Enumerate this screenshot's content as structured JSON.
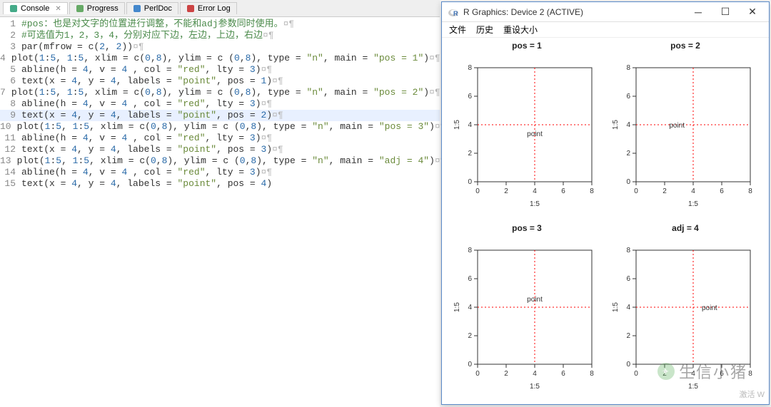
{
  "tabs": [
    {
      "label": "Console",
      "icon": "console-icon",
      "active": true
    },
    {
      "label": "Progress",
      "icon": "progress-icon",
      "active": false
    },
    {
      "label": "PerlDoc",
      "icon": "perldoc-icon",
      "active": false
    },
    {
      "label": "Error Log",
      "icon": "errorlog-icon",
      "active": false
    }
  ],
  "code": {
    "highlighted": 9,
    "lines": [
      {
        "n": 1,
        "seg": [
          [
            "c-comment",
            "#pos：也是对文字的位置进行调整，不能和adj参数同时使用。"
          ]
        ],
        "eol": "¤¶"
      },
      {
        "n": 2,
        "seg": [
          [
            "c-comment",
            "#可选值为1，2，3，4，分别对应下边，左边，上边，右边"
          ]
        ],
        "eol": "¤¶"
      },
      {
        "n": 3,
        "seg": [
          [
            "c-func",
            "par(mfrow = c("
          ],
          [
            "c-num",
            "2"
          ],
          [
            "c-func",
            ", "
          ],
          [
            "c-num",
            "2"
          ],
          [
            "c-func",
            "))"
          ]
        ],
        "eol": "¤¶"
      },
      {
        "n": 4,
        "seg": [
          [
            "c-func",
            "plot("
          ],
          [
            "c-num",
            "1"
          ],
          [
            "c-func",
            ":"
          ],
          [
            "c-num",
            "5"
          ],
          [
            "c-func",
            ", "
          ],
          [
            "c-num",
            "1"
          ],
          [
            "c-func",
            ":"
          ],
          [
            "c-num",
            "5"
          ],
          [
            "c-func",
            ", xlim = c("
          ],
          [
            "c-num",
            "0"
          ],
          [
            "c-func",
            ","
          ],
          [
            "c-num",
            "8"
          ],
          [
            "c-func",
            "), ylim = c ("
          ],
          [
            "c-num",
            "0"
          ],
          [
            "c-func",
            ","
          ],
          [
            "c-num",
            "8"
          ],
          [
            "c-func",
            "), type = "
          ],
          [
            "c-string",
            "\"n\""
          ],
          [
            "c-func",
            ", main = "
          ],
          [
            "c-string",
            "\"pos = 1\""
          ],
          [
            "c-func",
            ")"
          ]
        ],
        "eol": "¤¶"
      },
      {
        "n": 5,
        "seg": [
          [
            "c-func",
            "abline(h = "
          ],
          [
            "c-num",
            "4"
          ],
          [
            "c-func",
            ", v = "
          ],
          [
            "c-num",
            "4"
          ],
          [
            "c-func",
            " , col = "
          ],
          [
            "c-string",
            "\"red\""
          ],
          [
            "c-func",
            ", lty = "
          ],
          [
            "c-num",
            "3"
          ],
          [
            "c-func",
            ")"
          ]
        ],
        "eol": "¤¶"
      },
      {
        "n": 6,
        "seg": [
          [
            "c-func",
            "text(x = "
          ],
          [
            "c-num",
            "4"
          ],
          [
            "c-func",
            ", y = "
          ],
          [
            "c-num",
            "4"
          ],
          [
            "c-func",
            ", labels = "
          ],
          [
            "c-string",
            "\"point\""
          ],
          [
            "c-func",
            ", pos = "
          ],
          [
            "c-num",
            "1"
          ],
          [
            "c-func",
            ")"
          ]
        ],
        "eol": "¤¶"
      },
      {
        "n": 7,
        "seg": [
          [
            "c-func",
            "plot("
          ],
          [
            "c-num",
            "1"
          ],
          [
            "c-func",
            ":"
          ],
          [
            "c-num",
            "5"
          ],
          [
            "c-func",
            ", "
          ],
          [
            "c-num",
            "1"
          ],
          [
            "c-func",
            ":"
          ],
          [
            "c-num",
            "5"
          ],
          [
            "c-func",
            ", xlim = c("
          ],
          [
            "c-num",
            "0"
          ],
          [
            "c-func",
            ","
          ],
          [
            "c-num",
            "8"
          ],
          [
            "c-func",
            "), ylim = c ("
          ],
          [
            "c-num",
            "0"
          ],
          [
            "c-func",
            ","
          ],
          [
            "c-num",
            "8"
          ],
          [
            "c-func",
            "), type = "
          ],
          [
            "c-string",
            "\"n\""
          ],
          [
            "c-func",
            ", main = "
          ],
          [
            "c-string",
            "\"pos = 2\""
          ],
          [
            "c-func",
            ")"
          ]
        ],
        "eol": "¤¶"
      },
      {
        "n": 8,
        "seg": [
          [
            "c-func",
            "abline(h = "
          ],
          [
            "c-num",
            "4"
          ],
          [
            "c-func",
            ", v = "
          ],
          [
            "c-num",
            "4"
          ],
          [
            "c-func",
            " , col = "
          ],
          [
            "c-string",
            "\"red\""
          ],
          [
            "c-func",
            ", lty = "
          ],
          [
            "c-num",
            "3"
          ],
          [
            "c-func",
            ")"
          ]
        ],
        "eol": "¤¶"
      },
      {
        "n": 9,
        "seg": [
          [
            "c-func",
            "text(x = "
          ],
          [
            "c-num",
            "4"
          ],
          [
            "c-func",
            ", y = "
          ],
          [
            "c-num",
            "4"
          ],
          [
            "c-func",
            ", labels = "
          ],
          [
            "c-string",
            "\"point\""
          ],
          [
            "c-func",
            ", pos = "
          ],
          [
            "c-num",
            "2"
          ],
          [
            "c-func",
            ")"
          ]
        ],
        "eol": "¤¶"
      },
      {
        "n": 10,
        "seg": [
          [
            "c-func",
            "plot("
          ],
          [
            "c-num",
            "1"
          ],
          [
            "c-func",
            ":"
          ],
          [
            "c-num",
            "5"
          ],
          [
            "c-func",
            ", "
          ],
          [
            "c-num",
            "1"
          ],
          [
            "c-func",
            ":"
          ],
          [
            "c-num",
            "5"
          ],
          [
            "c-func",
            ", xlim = c("
          ],
          [
            "c-num",
            "0"
          ],
          [
            "c-func",
            ","
          ],
          [
            "c-num",
            "8"
          ],
          [
            "c-func",
            "), ylim = c ("
          ],
          [
            "c-num",
            "0"
          ],
          [
            "c-func",
            ","
          ],
          [
            "c-num",
            "8"
          ],
          [
            "c-func",
            "), type = "
          ],
          [
            "c-string",
            "\"n\""
          ],
          [
            "c-func",
            ", main = "
          ],
          [
            "c-string",
            "\"pos = 3\""
          ],
          [
            "c-func",
            ")"
          ]
        ],
        "eol": "¤¶"
      },
      {
        "n": 11,
        "seg": [
          [
            "c-func",
            "abline(h = "
          ],
          [
            "c-num",
            "4"
          ],
          [
            "c-func",
            ", v = "
          ],
          [
            "c-num",
            "4"
          ],
          [
            "c-func",
            " , col = "
          ],
          [
            "c-string",
            "\"red\""
          ],
          [
            "c-func",
            ", lty = "
          ],
          [
            "c-num",
            "3"
          ],
          [
            "c-func",
            ")"
          ]
        ],
        "eol": "¤¶"
      },
      {
        "n": 12,
        "seg": [
          [
            "c-func",
            "text(x = "
          ],
          [
            "c-num",
            "4"
          ],
          [
            "c-func",
            ", y = "
          ],
          [
            "c-num",
            "4"
          ],
          [
            "c-func",
            ", labels = "
          ],
          [
            "c-string",
            "\"point\""
          ],
          [
            "c-func",
            ", pos = "
          ],
          [
            "c-num",
            "3"
          ],
          [
            "c-func",
            ")"
          ]
        ],
        "eol": "¤¶"
      },
      {
        "n": 13,
        "seg": [
          [
            "c-func",
            "plot("
          ],
          [
            "c-num",
            "1"
          ],
          [
            "c-func",
            ":"
          ],
          [
            "c-num",
            "5"
          ],
          [
            "c-func",
            ", "
          ],
          [
            "c-num",
            "1"
          ],
          [
            "c-func",
            ":"
          ],
          [
            "c-num",
            "5"
          ],
          [
            "c-func",
            ", xlim = c("
          ],
          [
            "c-num",
            "0"
          ],
          [
            "c-func",
            ","
          ],
          [
            "c-num",
            "8"
          ],
          [
            "c-func",
            "), ylim = c ("
          ],
          [
            "c-num",
            "0"
          ],
          [
            "c-func",
            ","
          ],
          [
            "c-num",
            "8"
          ],
          [
            "c-func",
            "), type = "
          ],
          [
            "c-string",
            "\"n\""
          ],
          [
            "c-func",
            ", main = "
          ],
          [
            "c-string",
            "\"adj = 4\""
          ],
          [
            "c-func",
            ")"
          ]
        ],
        "eol": "¤¶"
      },
      {
        "n": 14,
        "seg": [
          [
            "c-func",
            "abline(h = "
          ],
          [
            "c-num",
            "4"
          ],
          [
            "c-func",
            ", v = "
          ],
          [
            "c-num",
            "4"
          ],
          [
            "c-func",
            " , col = "
          ],
          [
            "c-string",
            "\"red\""
          ],
          [
            "c-func",
            ", lty = "
          ],
          [
            "c-num",
            "3"
          ],
          [
            "c-func",
            ")"
          ]
        ],
        "eol": "¤¶"
      },
      {
        "n": 15,
        "seg": [
          [
            "c-func",
            "text(x = "
          ],
          [
            "c-num",
            "4"
          ],
          [
            "c-func",
            ", y = "
          ],
          [
            "c-num",
            "4"
          ],
          [
            "c-func",
            ", labels = "
          ],
          [
            "c-string",
            "\"point\""
          ],
          [
            "c-func",
            ", pos = "
          ],
          [
            "c-num",
            "4"
          ],
          [
            "c-func",
            ")"
          ]
        ],
        "eol": ""
      }
    ]
  },
  "graphics": {
    "title": "R Graphics: Device 2 (ACTIVE)",
    "menu": [
      "文件",
      "历史",
      "重设大小"
    ]
  },
  "chart_data": [
    {
      "type": "scatter",
      "title": "pos = 1",
      "xlabel": "1:5",
      "ylabel": "1:5",
      "xlim": [
        0,
        8
      ],
      "ylim": [
        0,
        8
      ],
      "ticks": [
        0,
        2,
        4,
        6,
        8
      ],
      "abline": {
        "h": 4,
        "v": 4,
        "col": "red",
        "lty": 3
      },
      "text": {
        "x": 4,
        "y": 4,
        "label": "point",
        "pos": 1
      }
    },
    {
      "type": "scatter",
      "title": "pos = 2",
      "xlabel": "1:5",
      "ylabel": "1:5",
      "xlim": [
        0,
        8
      ],
      "ylim": [
        0,
        8
      ],
      "ticks": [
        0,
        2,
        4,
        6,
        8
      ],
      "abline": {
        "h": 4,
        "v": 4,
        "col": "red",
        "lty": 3
      },
      "text": {
        "x": 4,
        "y": 4,
        "label": "point",
        "pos": 2
      }
    },
    {
      "type": "scatter",
      "title": "pos = 3",
      "xlabel": "1:5",
      "ylabel": "1:5",
      "xlim": [
        0,
        8
      ],
      "ylim": [
        0,
        8
      ],
      "ticks": [
        0,
        2,
        4,
        6,
        8
      ],
      "abline": {
        "h": 4,
        "v": 4,
        "col": "red",
        "lty": 3
      },
      "text": {
        "x": 4,
        "y": 4,
        "label": "point",
        "pos": 3
      }
    },
    {
      "type": "scatter",
      "title": "adj = 4",
      "xlabel": "1:5",
      "ylabel": "1:5",
      "xlim": [
        0,
        8
      ],
      "ylim": [
        0,
        8
      ],
      "ticks": [
        0,
        2,
        4,
        6,
        8
      ],
      "abline": {
        "h": 4,
        "v": 4,
        "col": "red",
        "lty": 3
      },
      "text": {
        "x": 4,
        "y": 4,
        "label": "point",
        "pos": 4
      }
    }
  ],
  "watermark": "生信小猪",
  "activate": "激活 W"
}
